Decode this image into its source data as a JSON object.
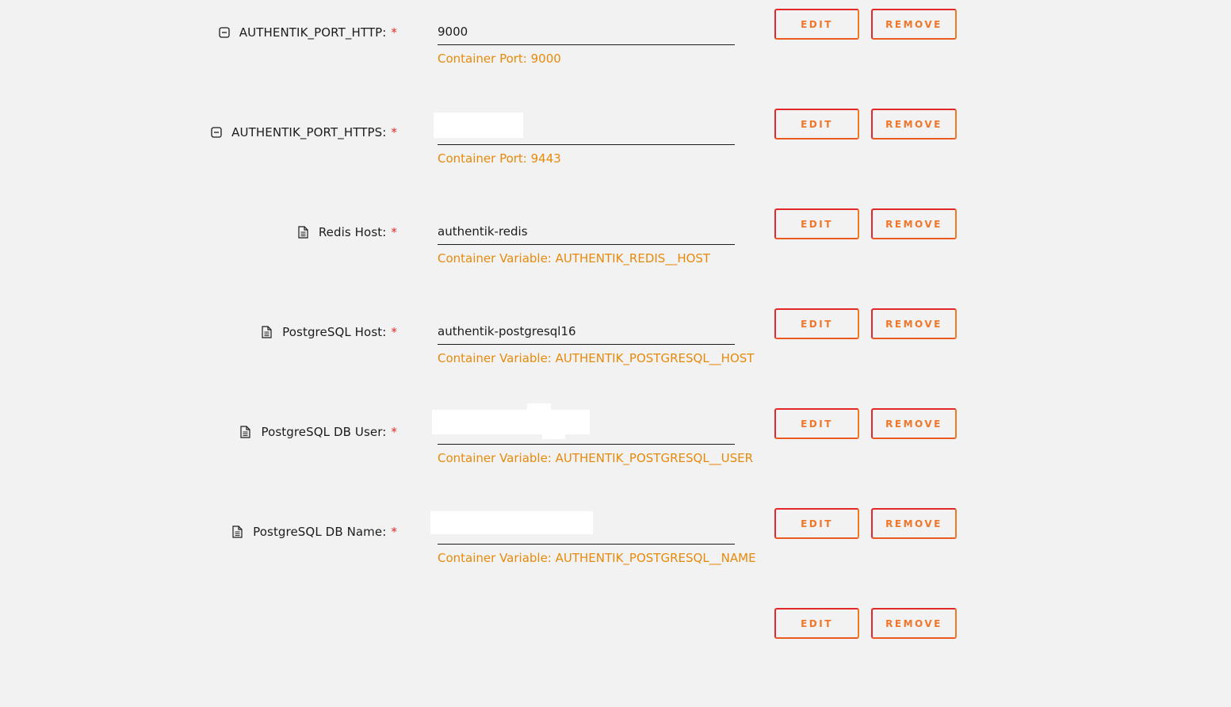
{
  "buttons": {
    "edit_label": "EDIT",
    "remove_label": "REMOVE"
  },
  "required_marker": "*",
  "rows": [
    {
      "icon": "minus-square-icon",
      "label": "AUTHENTIK_PORT_HTTP:",
      "value": "9000",
      "redacted": false,
      "hint": "Container Port: 9000"
    },
    {
      "icon": "minus-square-icon",
      "label": "AUTHENTIK_PORT_HTTPS:",
      "value": "",
      "redacted": true,
      "hint": "Container Port: 9443"
    },
    {
      "icon": "document-icon",
      "label": "Redis Host:",
      "value": "authentik-redis",
      "redacted": false,
      "hint": "Container Variable: AUTHENTIK_REDIS__HOST"
    },
    {
      "icon": "document-icon",
      "label": "PostgreSQL Host:",
      "value": "authentik-postgresql16",
      "redacted": false,
      "hint": "Container Variable: AUTHENTIK_POSTGRESQL__HOST"
    },
    {
      "icon": "document-icon",
      "label": "PostgreSQL DB User:",
      "value": "",
      "redacted": true,
      "hint": "Container Variable: AUTHENTIK_POSTGRESQL__USER"
    },
    {
      "icon": "document-icon",
      "label": "PostgreSQL DB Name:",
      "value": "",
      "redacted": true,
      "hint": "Container Variable: AUTHENTIK_POSTGRESQL__NAME"
    },
    {
      "icon": "",
      "label": "",
      "value": "",
      "redacted": false,
      "hint": ""
    }
  ],
  "colors": {
    "background": "#f2f2f2",
    "label_text": "#1c1c1c",
    "required_marker": "#e22828",
    "hint_text": "#e78a0c",
    "button_border_start": "#e22828",
    "button_border_end": "#ef7a1f",
    "button_text": "#f0762a"
  }
}
